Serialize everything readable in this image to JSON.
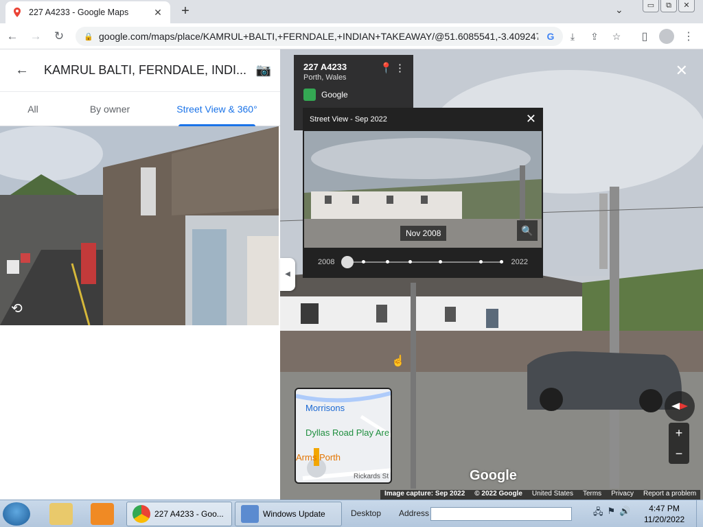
{
  "browser": {
    "tab_title": "227 A4233 - Google Maps",
    "tab_close": "✕",
    "new_tab": "+",
    "url": "google.com/maps/place/KAMRUL+BALTI,+FERNDALE,+INDIAN+TAKEAWAY/@51.6085541,-3.4092479...",
    "window_buttons": [
      "▭",
      "⧉",
      "✕"
    ]
  },
  "place_panel": {
    "title": "KAMRUL BALTI, FERNDALE, INDI...",
    "tabs": [
      "All",
      "By owner",
      "Street View & 360°"
    ],
    "active_tab_index": 2
  },
  "street_view": {
    "address_line1": "227 A4233",
    "address_line2": "Porth, Wales",
    "source": "Google",
    "time_machine": {
      "header": "Street View - Sep 2022",
      "date_label": "Nov 2008",
      "start_year": "2008",
      "end_year": "2022"
    },
    "minimap": {
      "place1": "Morrisons",
      "place2": "Dyllas Road Play Are",
      "place3": "Arms Porth",
      "road": "Rickards St"
    },
    "logo": "Google",
    "footer": [
      "Image capture: Sep 2022",
      "© 2022 Google",
      "United States",
      "Terms",
      "Privacy",
      "Report a problem"
    ],
    "zoom_in": "+",
    "zoom_out": "−"
  },
  "taskbar": {
    "chrome_task": "227 A4233 - Goo...",
    "update_task": "Windows Update",
    "desktop": "Desktop",
    "address_label": "Address",
    "time": "4:47 PM",
    "date": "11/20/2022"
  }
}
